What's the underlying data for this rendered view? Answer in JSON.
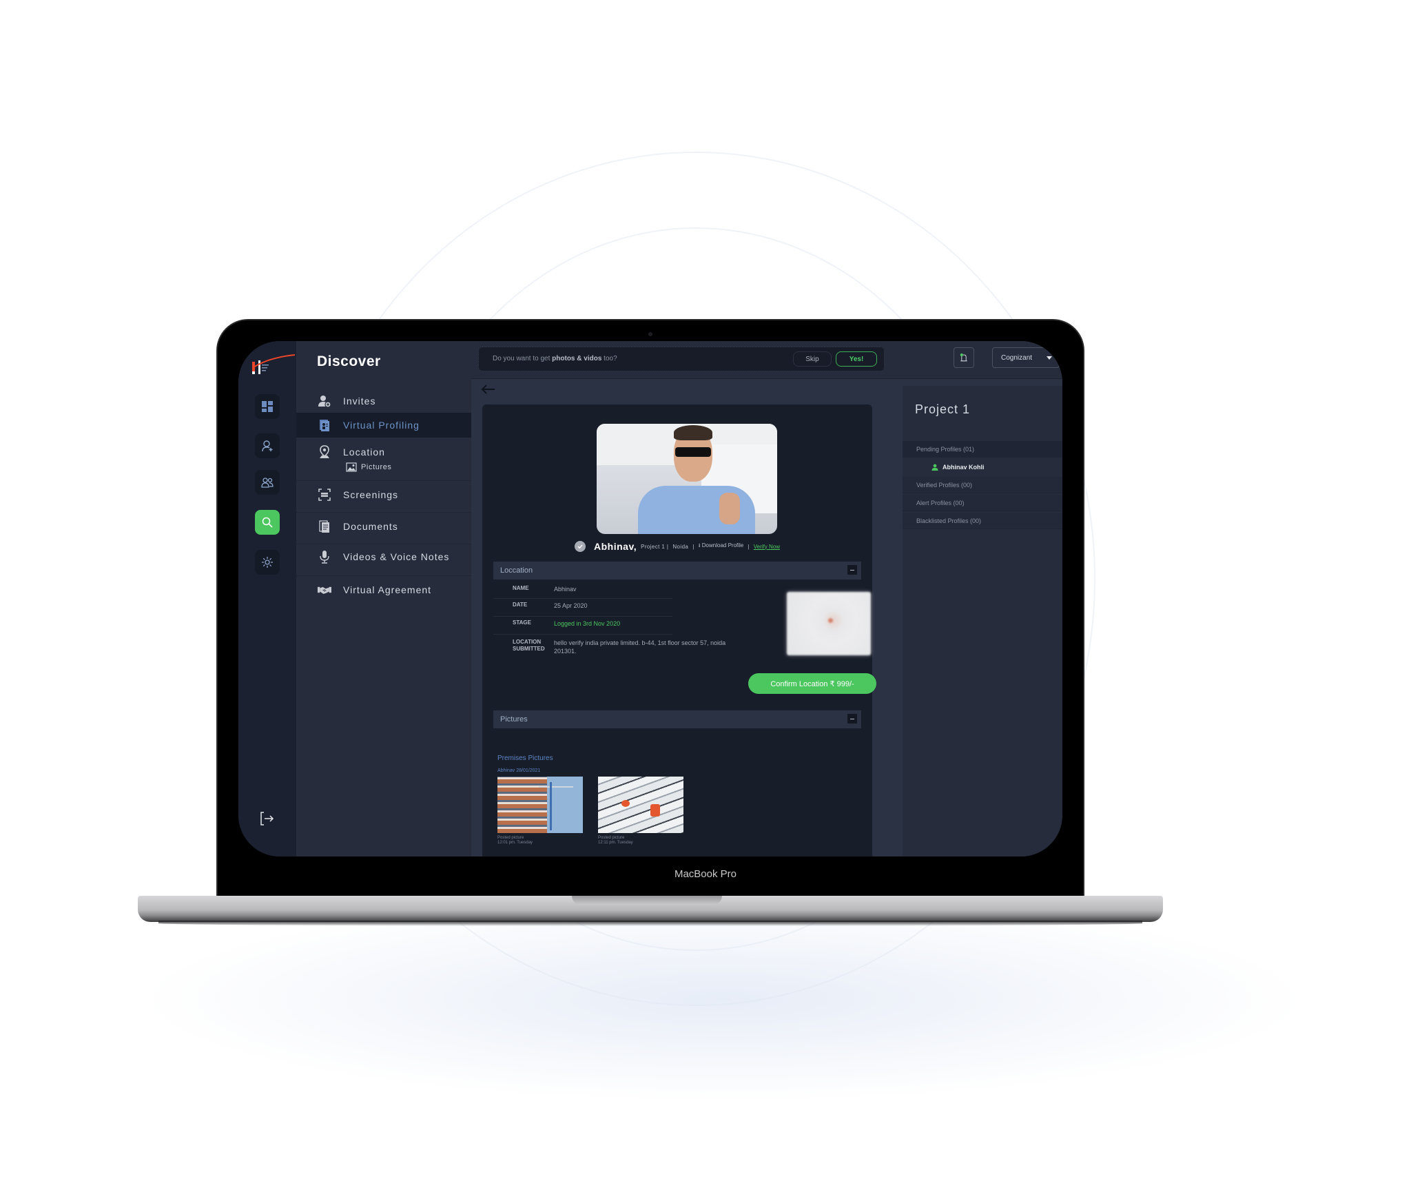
{
  "device": {
    "brand_label": "MacBook Pro"
  },
  "colors": {
    "accent_green": "#4cc760",
    "link_blue": "#5d86c4",
    "bg_dark": "#181d2a",
    "panel": "#262c3c",
    "logo_red": "#e8452a"
  },
  "rail": {
    "items": [
      {
        "name": "dashboard",
        "icon": "dashboard-icon",
        "active": false
      },
      {
        "name": "add-user",
        "icon": "add-user-icon",
        "active": false
      },
      {
        "name": "users",
        "icon": "users-icon",
        "active": false
      },
      {
        "name": "discover",
        "icon": "search-icon",
        "active": true
      },
      {
        "name": "settings",
        "icon": "gear-icon",
        "active": false
      }
    ],
    "logout_icon": "logout-icon"
  },
  "nav": {
    "title": "Discover",
    "items": [
      {
        "label": "Invites",
        "icon": "invite-user-icon",
        "active": false
      },
      {
        "label": "Virtual Profiling",
        "icon": "profile-card-icon",
        "active": true
      },
      {
        "label": "Location",
        "icon": "location-pin-icon",
        "active": false
      },
      {
        "label": "Screenings",
        "icon": "scan-icon",
        "active": false
      },
      {
        "label": "Documents",
        "icon": "documents-icon",
        "active": false
      },
      {
        "label": "Videos & Voice Notes",
        "icon": "microphone-icon",
        "active": false
      },
      {
        "label": "Virtual Agreement",
        "icon": "handshake-icon",
        "active": false
      }
    ],
    "sub_item": {
      "label": "Pictures",
      "icon": "image-icon"
    }
  },
  "topbar": {
    "prompt_prefix": "Do you want to get ",
    "prompt_bold": "photos & vidos",
    "prompt_suffix": " too?",
    "skip_label": "Skip",
    "yes_label": "Yes!",
    "company": "Cognizant"
  },
  "profile": {
    "name": "Abhinav,",
    "project": "Project 1 |",
    "city": "Noida",
    "separator": "|",
    "download_label": "Download Profile",
    "verify_label": "Verify Now"
  },
  "location_section": {
    "title": "Loccation",
    "rows": [
      {
        "label": "NAME",
        "value": "Abhinav"
      },
      {
        "label": "DATE",
        "value": "25 Apr 2020"
      },
      {
        "label": "STAGE",
        "value": "Logged in 3rd Nov 2020"
      },
      {
        "label": "LOCATION SUBMITTED",
        "value": "hello verify india private limited. b-44, 1st floor sector 57, noida 201301."
      }
    ],
    "confirm_label": "Confirm Location ₹ 999/-"
  },
  "pictures_section": {
    "title": "Pictures",
    "group_title": "Premises Pictures",
    "group_sub": "Abhinav 28/01/2021",
    "items": [
      {
        "caption1": "Posted picture",
        "caption2": "12:01 pm. Tuesday"
      },
      {
        "caption1": "Posted picture",
        "caption2": "12:11 pm. Tuesday"
      }
    ]
  },
  "right_panel": {
    "title": "Project 1",
    "pending": "Pending Profiles (01)",
    "pending_person": "Abhinav Kohli",
    "verified": "Verified Profiles (00)",
    "alert": "Alert Profiles (00)",
    "blacklisted": "Blacklisted Profiles (00)"
  }
}
